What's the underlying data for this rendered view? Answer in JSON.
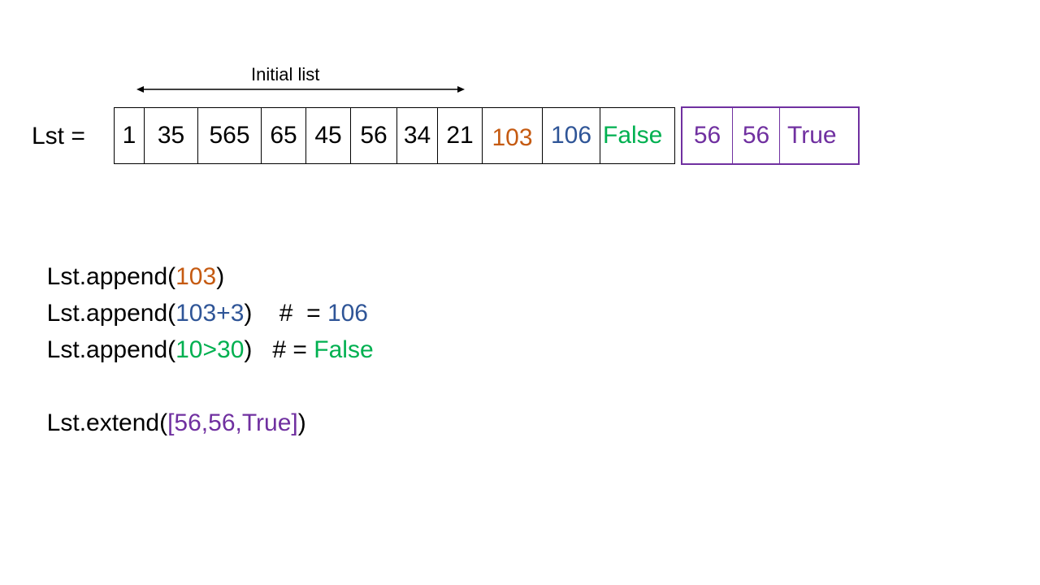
{
  "caption": "Initial list",
  "list_label": "Lst =",
  "colors": {
    "black": "#000000",
    "orange": "#c55a11",
    "blue": "#2f5597",
    "green": "#00b050",
    "purple": "#7030a0"
  },
  "main_cells": [
    {
      "text": "1",
      "color": "#000000"
    },
    {
      "text": "35",
      "color": "#000000"
    },
    {
      "text": "565",
      "color": "#000000"
    },
    {
      "text": "65",
      "color": "#000000"
    },
    {
      "text": "45",
      "color": "#000000"
    },
    {
      "text": "56",
      "color": "#000000"
    },
    {
      "text": "34",
      "color": "#000000"
    },
    {
      "text": "21",
      "color": "#000000"
    },
    {
      "text": "103",
      "color": "#c55a11"
    },
    {
      "text": "106",
      "color": "#2f5597"
    },
    {
      "text": "False",
      "color": "#00b050"
    }
  ],
  "extend_cells": [
    {
      "text": "56",
      "color": "#7030a0"
    },
    {
      "text": "56",
      "color": "#7030a0"
    },
    {
      "text": "True",
      "color": "#7030a0"
    }
  ],
  "code": [
    [
      {
        "text": "Lst.append(",
        "color": "#000000"
      },
      {
        "text": "103",
        "color": "#c55a11"
      },
      {
        "text": ")",
        "color": "#000000"
      }
    ],
    [
      {
        "text": "Lst.append(",
        "color": "#000000"
      },
      {
        "text": "103+3",
        "color": "#2f5597"
      },
      {
        "text": ")    #  = ",
        "color": "#000000"
      },
      {
        "text": "106",
        "color": "#2f5597"
      }
    ],
    [
      {
        "text": "Lst.append(",
        "color": "#000000"
      },
      {
        "text": "10>30",
        "color": "#00b050"
      },
      {
        "text": ")   # = ",
        "color": "#000000"
      },
      {
        "text": "False",
        "color": "#00b050"
      }
    ],
    [
      {
        "text": "Lst.extend(",
        "color": "#000000"
      },
      {
        "text": "[56,56,True]",
        "color": "#7030a0"
      },
      {
        "text": ")",
        "color": "#000000"
      }
    ]
  ]
}
